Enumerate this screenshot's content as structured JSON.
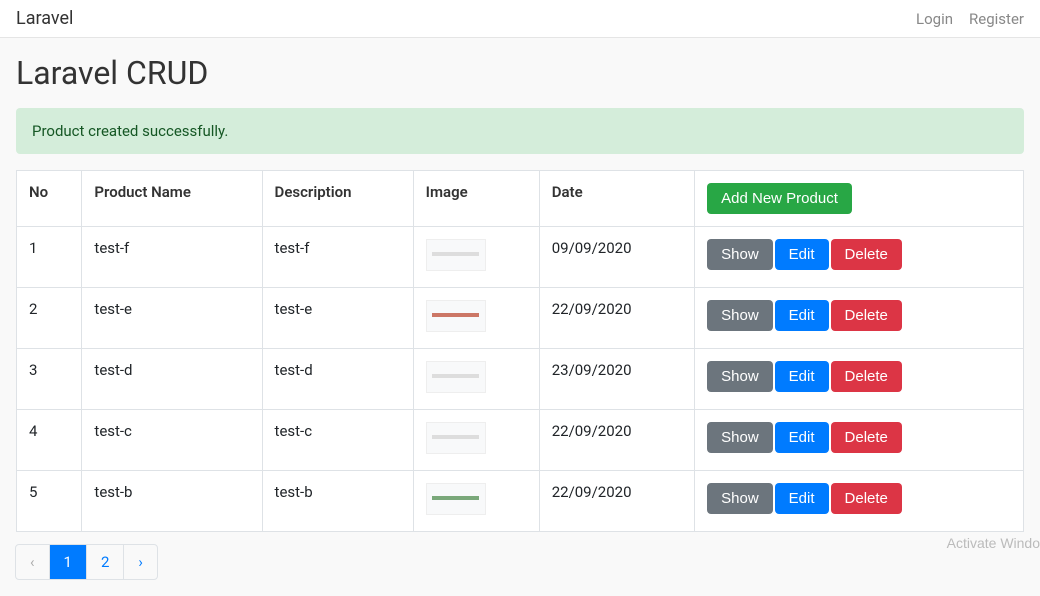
{
  "navbar": {
    "brand": "Laravel",
    "login": "Login",
    "register": "Register"
  },
  "page": {
    "title": "Laravel CRUD",
    "alert": "Product created successfully."
  },
  "table": {
    "headers": {
      "no": "No",
      "name": "Product Name",
      "description": "Description",
      "image": "Image",
      "date": "Date"
    },
    "add_button": "Add New Product",
    "actions": {
      "show": "Show",
      "edit": "Edit",
      "delete": "Delete"
    },
    "rows": [
      {
        "no": "1",
        "name": "test-f",
        "description": "test-f",
        "date": "09/09/2020",
        "thumb": ""
      },
      {
        "no": "2",
        "name": "test-e",
        "description": "test-e",
        "date": "22/09/2020",
        "thumb": "red"
      },
      {
        "no": "3",
        "name": "test-d",
        "description": "test-d",
        "date": "23/09/2020",
        "thumb": ""
      },
      {
        "no": "4",
        "name": "test-c",
        "description": "test-c",
        "date": "22/09/2020",
        "thumb": ""
      },
      {
        "no": "5",
        "name": "test-b",
        "description": "test-b",
        "date": "22/09/2020",
        "thumb": "green"
      }
    ]
  },
  "pagination": {
    "prev": "‹",
    "pages": [
      "1",
      "2"
    ],
    "current": "1",
    "next": "›"
  },
  "watermark": "Activate Windo"
}
